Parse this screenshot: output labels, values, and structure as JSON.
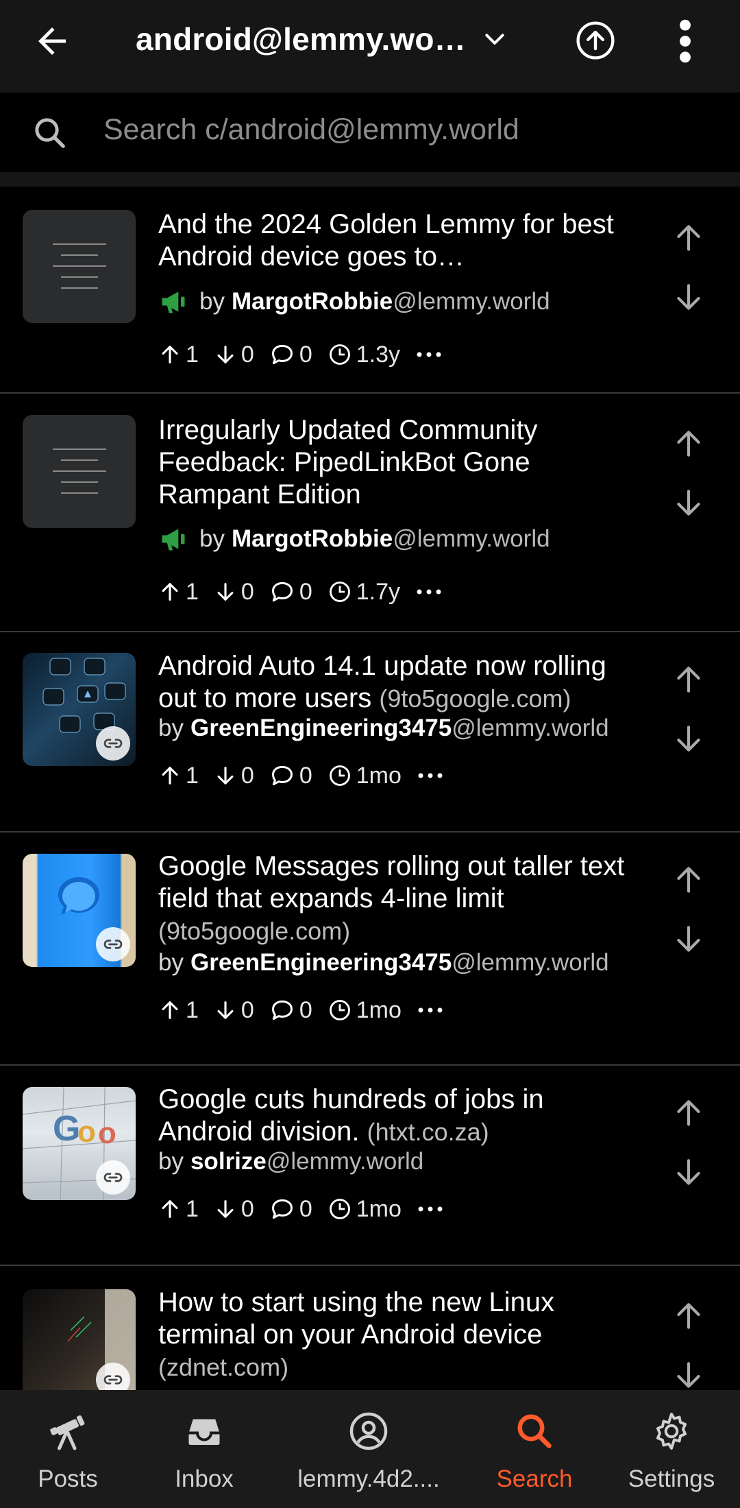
{
  "header": {
    "title": "android@lemmy.wo…",
    "search_placeholder": "Search c/android@lemmy.world"
  },
  "posts": [
    {
      "title": "And the 2024 Golden Lemmy for best Android device goes to…",
      "domain": "",
      "by": "by",
      "user": "MargotRobbie",
      "instance": "@lemmy.world",
      "moderator": true,
      "upvotes": "1",
      "downvotes": "0",
      "comments": "0",
      "age": "1.3y",
      "thumb": "text"
    },
    {
      "title": "Irregularly Updated Community Feedback: PipedLinkBot Gone Rampant Edition",
      "domain": "",
      "by": "by",
      "user": "MargotRobbie",
      "instance": "@lemmy.world",
      "moderator": true,
      "upvotes": "1",
      "downvotes": "0",
      "comments": "0",
      "age": "1.7y",
      "thumb": "text"
    },
    {
      "title": "Android Auto 14.1 update now rolling out to more users",
      "domain": "(9to5google.com)",
      "by": "by",
      "user": "GreenEngineering3475",
      "instance": "@lemmy.world",
      "moderator": false,
      "upvotes": "1",
      "downvotes": "0",
      "comments": "0",
      "age": "1mo",
      "thumb": "car"
    },
    {
      "title": "Google Messages rolling out taller text field that expands 4-line limit",
      "domain": "(9to5google.com)",
      "by": "by",
      "user": "GreenEngineering3475",
      "instance": "@lemmy.world",
      "moderator": false,
      "upvotes": "1",
      "downvotes": "0",
      "comments": "0",
      "age": "1mo",
      "thumb": "messages"
    },
    {
      "title": "Google cuts hundreds of jobs in Android division.",
      "domain": "(htxt.co.za)",
      "by": "by",
      "user": "solrize",
      "instance": "@lemmy.world",
      "moderator": false,
      "upvotes": "1",
      "downvotes": "0",
      "comments": "0",
      "age": "1mo",
      "thumb": "google"
    },
    {
      "title": "How to start using the new Linux terminal on your Android device",
      "domain": "(zdnet.com)",
      "by": "",
      "user": "",
      "instance": "",
      "moderator": false,
      "upvotes": "",
      "downvotes": "",
      "comments": "",
      "age": "",
      "thumb": "terminal"
    }
  ],
  "nav": [
    {
      "label": "Posts",
      "icon": "telescope-icon",
      "active": false
    },
    {
      "label": "Inbox",
      "icon": "inbox-icon",
      "active": false
    },
    {
      "label": "lemmy.4d2....",
      "icon": "account-icon",
      "active": false
    },
    {
      "label": "Search",
      "icon": "search-icon",
      "active": true
    },
    {
      "label": "Settings",
      "icon": "gear-icon",
      "active": false
    }
  ],
  "colors": {
    "accent": "#ff5a2c",
    "moderator": "#2ea043",
    "background": "#000000",
    "bar": "#161616"
  }
}
